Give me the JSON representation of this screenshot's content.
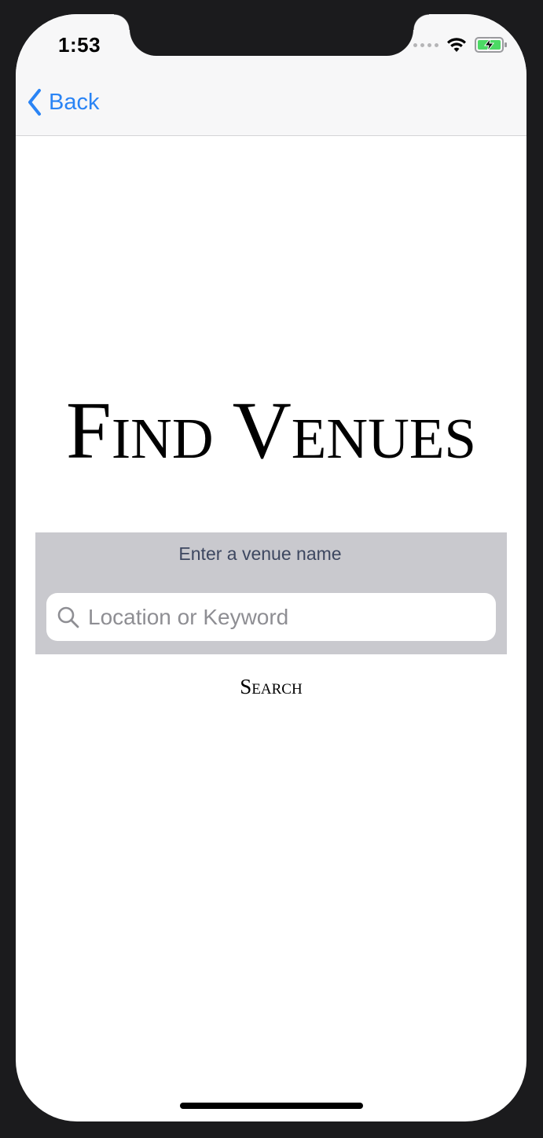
{
  "status_bar": {
    "time": "1:53",
    "wifi_icon": "wifi-icon",
    "battery_icon": "battery-charging-icon",
    "battery_color": "#4cd964"
  },
  "nav": {
    "back_label": "Back",
    "back_icon": "chevron-left-icon",
    "accent_color": "#2a84f5"
  },
  "main": {
    "title": "Find Venues",
    "search_prompt": "Enter a venue name",
    "search_placeholder": "Location or Keyword",
    "search_value": "",
    "search_button_label": "Search"
  }
}
